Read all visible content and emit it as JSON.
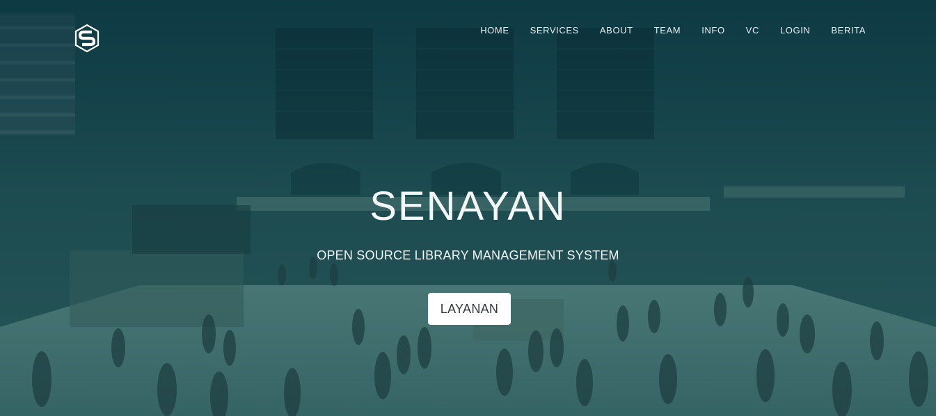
{
  "brand": {
    "logo_icon": "senayan-s-hexagon-icon"
  },
  "nav": {
    "items": [
      {
        "label": "HOME"
      },
      {
        "label": "SERVICES"
      },
      {
        "label": "ABOUT"
      },
      {
        "label": "TEAM"
      },
      {
        "label": "INFO"
      },
      {
        "label": "VC"
      },
      {
        "label": "LOGIN"
      },
      {
        "label": "BERITA"
      }
    ]
  },
  "hero": {
    "title": "SENAYAN",
    "subtitle": "OPEN SOURCE LIBRARY MANAGEMENT SYSTEM",
    "cta_label": "LAYANAN",
    "background_icon": "train-station-concourse-photo",
    "overlay_color": "#0f3d46",
    "button_color": "#ffffff"
  }
}
